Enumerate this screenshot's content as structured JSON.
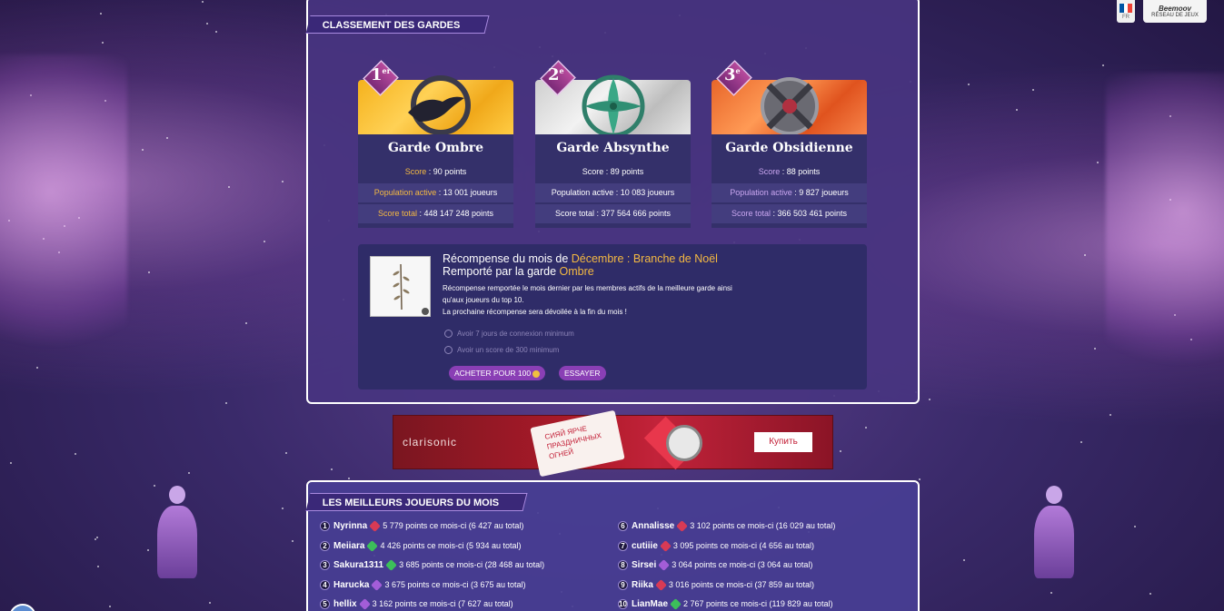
{
  "topbar": {
    "lang_code": "FR",
    "network_logo": "Beemoov",
    "network_label": "RÉSEAU DE JEUX"
  },
  "ranking": {
    "section_title": "CLASSEMENT DES GARDES",
    "cards": [
      {
        "rank": "1",
        "rank_suffix": "er",
        "name": "Garde Ombre",
        "score_label": "Score",
        "score_value": "90 points",
        "pop_label": "Population active",
        "pop_value": "13 001 joueurs",
        "total_label": "Score total",
        "total_value": "448 147 248 points",
        "label_color": "#f4b942",
        "banner": "gold",
        "emblem": "raven-emblem-icon"
      },
      {
        "rank": "2",
        "rank_suffix": "e",
        "name": "Garde Absynthe",
        "score_label": "Score",
        "score_value": "89 points",
        "pop_label": "Population active",
        "pop_value": "10 083 joueurs",
        "total_label": "Score total",
        "total_value": "377 564 666 points",
        "label_color": "#ffffff",
        "banner": "silver",
        "emblem": "leaf-emblem-icon"
      },
      {
        "rank": "3",
        "rank_suffix": "e",
        "name": "Garde Obsidienne",
        "score_label": "Score",
        "score_value": "88 points",
        "pop_label": "Population active",
        "pop_value": "9 827 joueurs",
        "total_label": "Score total",
        "total_value": "366 503 461 points",
        "label_color": "#c9a6f0",
        "banner": "orange",
        "emblem": "shield-emblem-icon"
      }
    ]
  },
  "reward": {
    "line1_prefix": "Récompense du mois de ",
    "line1_month": "Décembre : Branche de Noël",
    "line2_prefix": "Remporté par la garde ",
    "line2_guard": "Ombre",
    "desc1": "Récompense remportée le mois dernier par les membres actifs de la meilleure garde ainsi",
    "desc2": "qu'aux joueurs du top 10.",
    "desc3": "La prochaine récompense sera dévoilée à la fin du mois !",
    "req1": "Avoir 7 jours de connexion minimum",
    "req2": "Avoir un score de 300 minimum",
    "buy_label": "ACHETER POUR 100",
    "try_label": "ESSAYER"
  },
  "ad": {
    "brand": "clarisonic",
    "tag_text": "СИЯЙ ЯРЧЕ ПРАЗДНИЧНЫХ ОГНЕЙ",
    "button": "Купить"
  },
  "leaderboard": {
    "section_title": "LES MEILLEURS JOUEURS DU MOIS",
    "players": [
      {
        "rank": "1",
        "name": "Nyrinna",
        "guard": "ombre",
        "stats": "5 779 points ce mois-ci (6 427 au total)"
      },
      {
        "rank": "2",
        "name": "Meiiara",
        "guard": "absynthe",
        "stats": "4 426 points ce mois-ci (5 934 au total)"
      },
      {
        "rank": "3",
        "name": "Sakura1311",
        "guard": "absynthe",
        "stats": "3 685 points ce mois-ci (28 468 au total)"
      },
      {
        "rank": "4",
        "name": "Harucka",
        "guard": "obsidienne",
        "stats": "3 675 points ce mois-ci (3 675 au total)"
      },
      {
        "rank": "5",
        "name": "hellix",
        "guard": "obsidienne",
        "stats": "3 162 points ce mois-ci (7 627 au total)"
      },
      {
        "rank": "6",
        "name": "Annalisse",
        "guard": "ombre",
        "stats": "3 102 points ce mois-ci (16 029 au total)"
      },
      {
        "rank": "7",
        "name": "cutiiie",
        "guard": "ombre",
        "stats": "3 095 points ce mois-ci (4 656 au total)"
      },
      {
        "rank": "8",
        "name": "Sirsei",
        "guard": "obsidienne",
        "stats": "3 064 points ce mois-ci (3 064 au total)"
      },
      {
        "rank": "9",
        "name": "Riika",
        "guard": "ombre",
        "stats": "3 016 points ce mois-ci (37 859 au total)"
      },
      {
        "rank": "10",
        "name": "LianMae",
        "guard": "absynthe",
        "stats": "2 767 points ce mois-ci (119 829 au total)"
      }
    ]
  }
}
